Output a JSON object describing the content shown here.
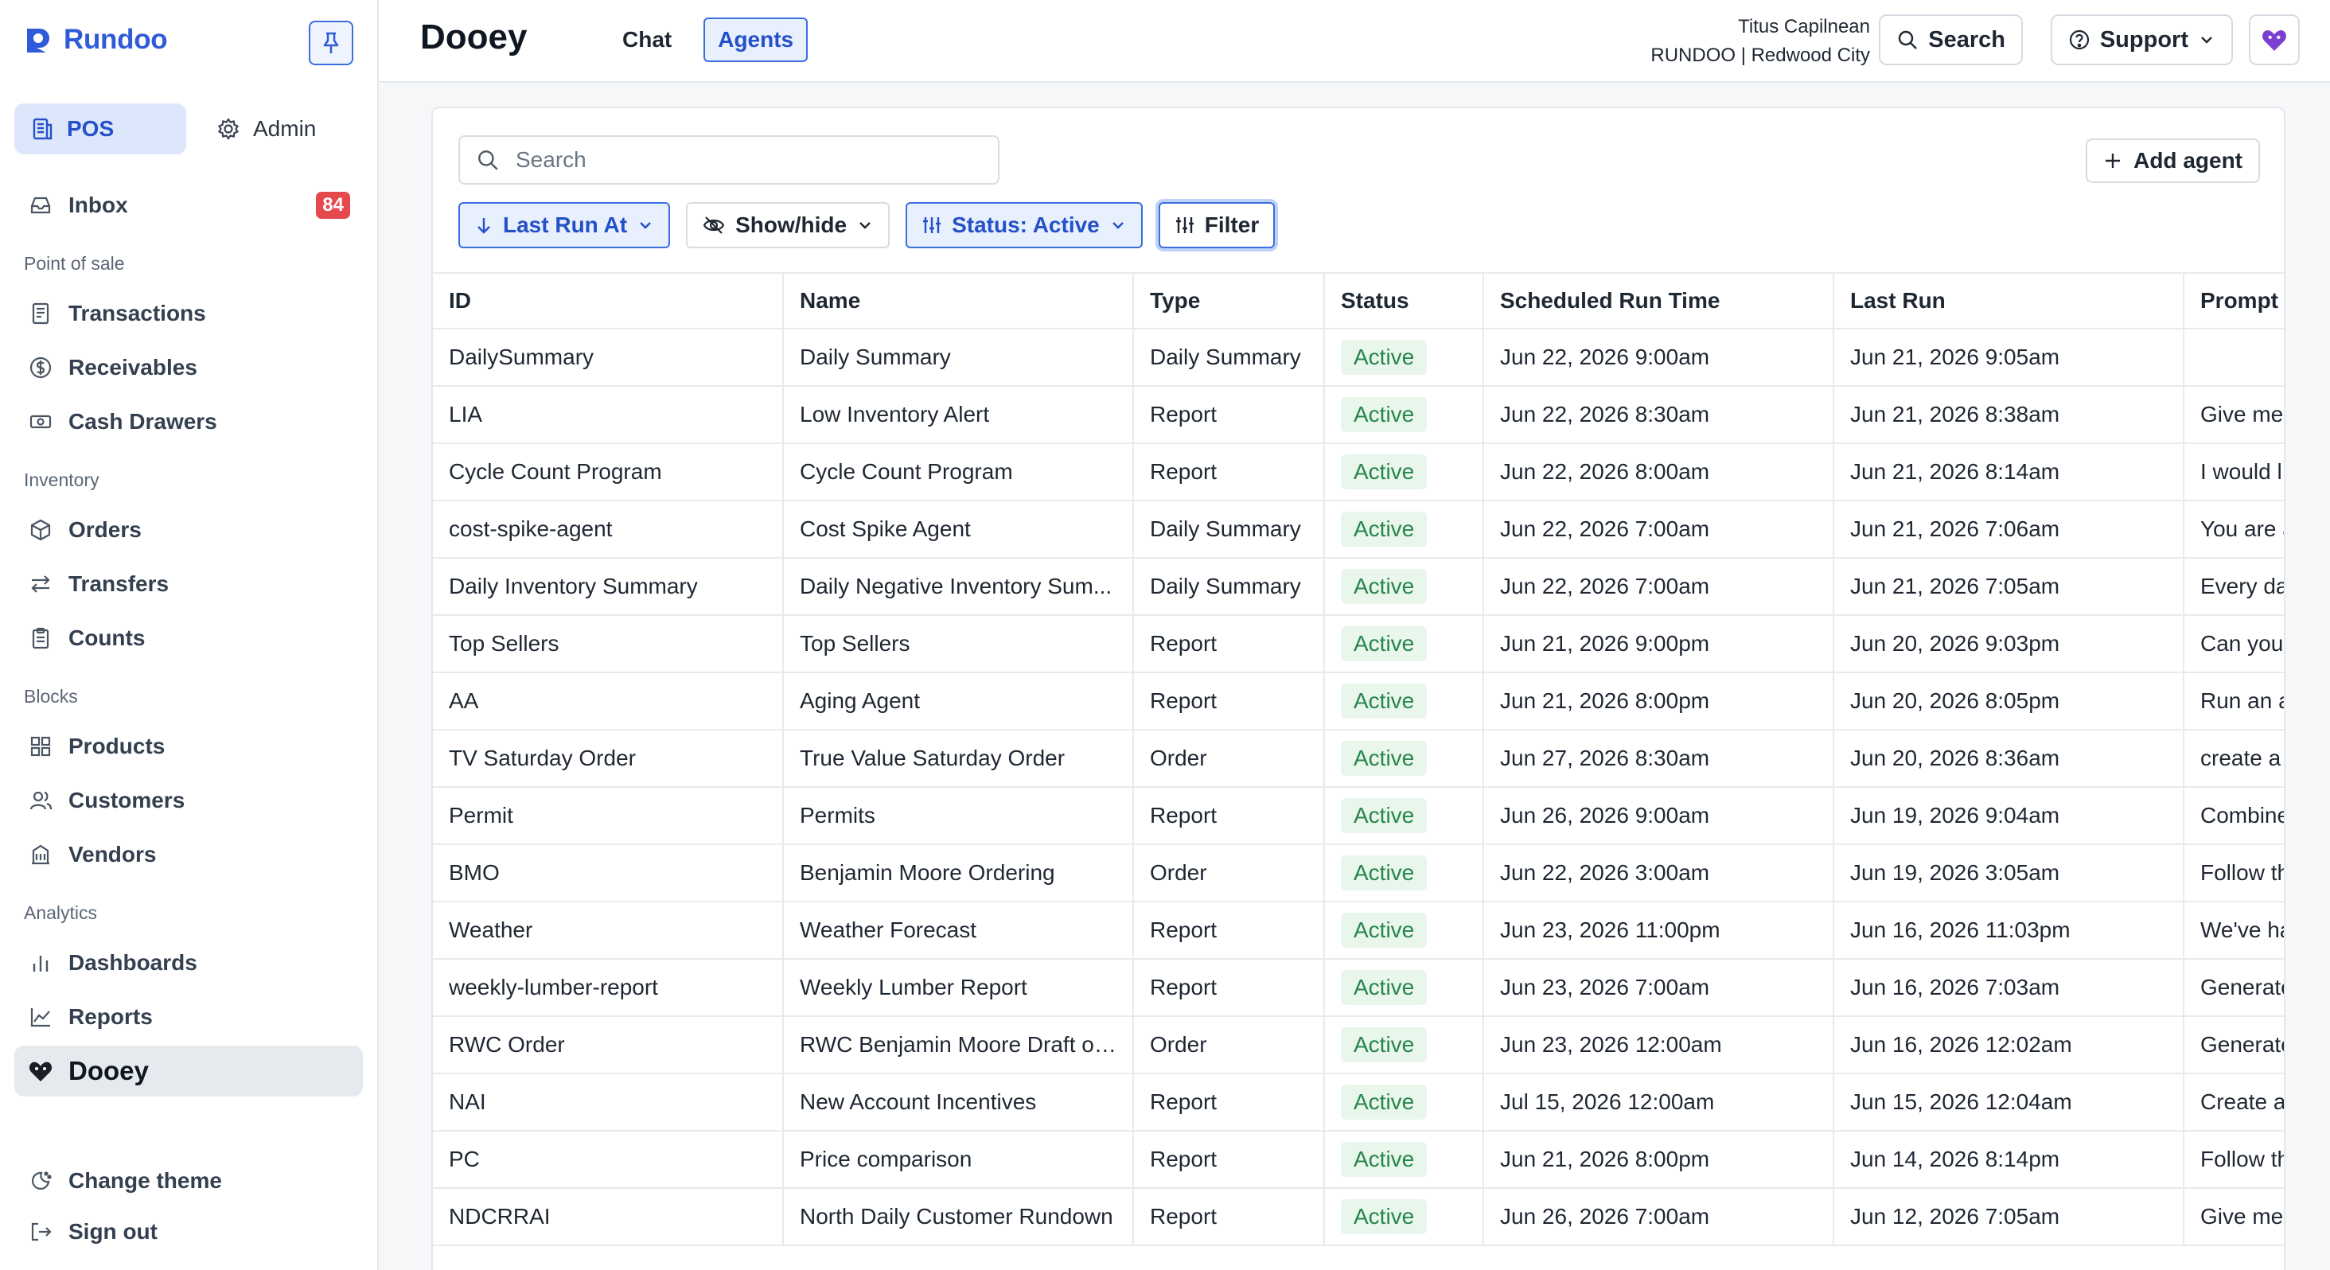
{
  "app": {
    "name": "Rundoo",
    "page_title": "Dooey"
  },
  "sidebar": {
    "modes": [
      {
        "label": "POS"
      },
      {
        "label": "Admin"
      }
    ],
    "inbox": {
      "label": "Inbox",
      "count": "84"
    },
    "sections": [
      {
        "title": "Point of sale",
        "items": [
          {
            "label": "Transactions",
            "icon": "receipt-icon"
          },
          {
            "label": "Receivables",
            "icon": "dollar-circle-icon"
          },
          {
            "label": "Cash Drawers",
            "icon": "cash-icon"
          }
        ]
      },
      {
        "title": "Inventory",
        "items": [
          {
            "label": "Orders",
            "icon": "box-icon"
          },
          {
            "label": "Transfers",
            "icon": "arrows-swap-icon"
          },
          {
            "label": "Counts",
            "icon": "clipboard-icon"
          }
        ]
      },
      {
        "title": "Blocks",
        "items": [
          {
            "label": "Products",
            "icon": "grid-icon"
          },
          {
            "label": "Customers",
            "icon": "users-icon"
          },
          {
            "label": "Vendors",
            "icon": "building-icon"
          }
        ]
      },
      {
        "title": "Analytics",
        "items": [
          {
            "label": "Dashboards",
            "icon": "bar-chart-icon"
          },
          {
            "label": "Reports",
            "icon": "line-chart-icon"
          }
        ]
      }
    ],
    "dooey": {
      "label": "Dooey"
    },
    "footer": [
      {
        "label": "Change theme"
      },
      {
        "label": "Sign out"
      }
    ]
  },
  "header": {
    "tabs": [
      {
        "label": "Chat"
      },
      {
        "label": "Agents"
      }
    ],
    "user": {
      "name": "Titus Capilnean",
      "org": "RUNDOO | Redwood City"
    },
    "search_label": "Search",
    "support_label": "Support"
  },
  "toolbar": {
    "search_placeholder": "Search",
    "add_label": "Add agent",
    "sort_label": "Last Run At",
    "showhide_label": "Show/hide",
    "status_label": "Status: Active",
    "filter_label": "Filter"
  },
  "table": {
    "columns": [
      "ID",
      "Name",
      "Type",
      "Status",
      "Scheduled Run Time",
      "Last Run",
      "Prompt"
    ],
    "rows": [
      [
        "DailySummary",
        "Daily Summary",
        "Daily Summary",
        "Active",
        "Jun 22, 2026 9:00am",
        "Jun 21, 2026 9:05am",
        ""
      ],
      [
        "LIA",
        "Low Inventory Alert",
        "Report",
        "Active",
        "Jun 22, 2026 8:30am",
        "Jun 21, 2026 8:38am",
        "Give me"
      ],
      [
        "Cycle Count Program",
        "Cycle Count Program",
        "Report",
        "Active",
        "Jun 22, 2026 8:00am",
        "Jun 21, 2026 8:14am",
        "I would l"
      ],
      [
        "cost-spike-agent",
        "Cost Spike Agent",
        "Daily Summary",
        "Active",
        "Jun 22, 2026 7:00am",
        "Jun 21, 2026 7:06am",
        "You are a"
      ],
      [
        "Daily Inventory Summary",
        "Daily Negative Inventory Sum...",
        "Daily Summary",
        "Active",
        "Jun 22, 2026 7:00am",
        "Jun 21, 2026 7:05am",
        "Every da"
      ],
      [
        "Top Sellers",
        "Top Sellers",
        "Report",
        "Active",
        "Jun 21, 2026 9:00pm",
        "Jun 20, 2026 9:03pm",
        "Can you"
      ],
      [
        "AA",
        "Aging Agent",
        "Report",
        "Active",
        "Jun 21, 2026 8:00pm",
        "Jun 20, 2026 8:05pm",
        "Run an a"
      ],
      [
        "TV Saturday Order",
        "True Value Saturday Order",
        "Order",
        "Active",
        "Jun 27, 2026 8:30am",
        "Jun 20, 2026 8:36am",
        "create a"
      ],
      [
        "Permit",
        "Permits",
        "Report",
        "Active",
        "Jun 26, 2026 9:00am",
        "Jun 19, 2026 9:04am",
        "Combine"
      ],
      [
        "BMO",
        "Benjamin Moore Ordering",
        "Order",
        "Active",
        "Jun 22, 2026 3:00am",
        "Jun 19, 2026 3:05am",
        "Follow th"
      ],
      [
        "Weather",
        "Weather Forecast",
        "Report",
        "Active",
        "Jun 23, 2026 11:00pm",
        "Jun 16, 2026 11:03pm",
        "We've ha"
      ],
      [
        "weekly-lumber-report",
        "Weekly Lumber Report",
        "Report",
        "Active",
        "Jun 23, 2026 7:00am",
        "Jun 16, 2026 7:03am",
        "Generate"
      ],
      [
        "RWC Order",
        "RWC Benjamin Moore Draft or...",
        "Order",
        "Active",
        "Jun 23, 2026 12:00am",
        "Jun 16, 2026 12:02am",
        "Generate"
      ],
      [
        "NAI",
        "New Account Incentives",
        "Report",
        "Active",
        "Jul 15, 2026 12:00am",
        "Jun 15, 2026 12:04am",
        "Create a"
      ],
      [
        "PC",
        "Price comparison",
        "Report",
        "Active",
        "Jun 21, 2026 8:00pm",
        "Jun 14, 2026 8:14pm",
        "Follow th"
      ],
      [
        "NDCRRAI",
        "North Daily Customer Rundown",
        "Report",
        "Active",
        "Jun 26, 2026 7:00am",
        "Jun 12, 2026 7:05am",
        "Give me"
      ]
    ]
  },
  "colors": {
    "accent": "#2f5bd8",
    "badge": "#e5484d",
    "status_active": "#27864a"
  }
}
